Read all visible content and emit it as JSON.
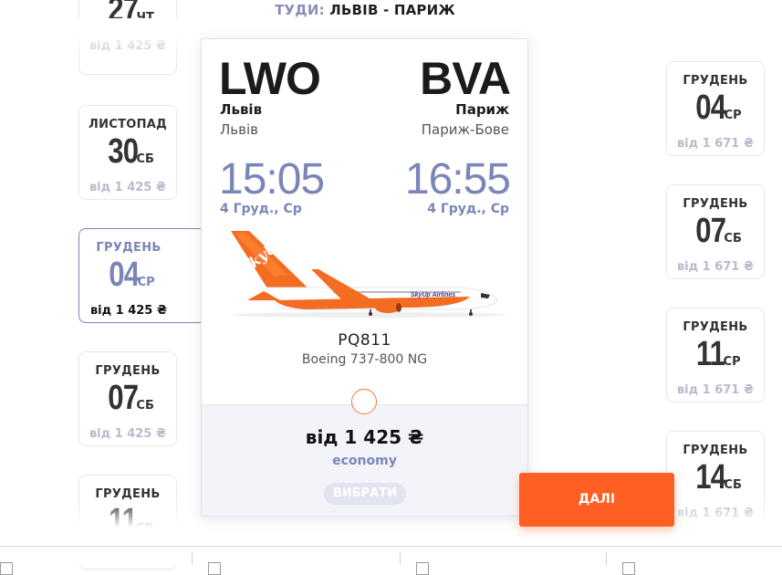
{
  "header": {
    "direction": "ТУДИ:",
    "route": "ЛЬВІВ - ПАРИЖ"
  },
  "left_dates": [
    {
      "month": "",
      "day": "27",
      "weekday": "ЧТ",
      "price": "від 1 425 ₴"
    },
    {
      "month": "ЛИСТОПАД",
      "day": "30",
      "weekday": "СБ",
      "price": "від 1 425 ₴"
    },
    {
      "month": "ГРУДЕНЬ",
      "day": "04",
      "weekday": "СР",
      "price": "від 1 425 ₴"
    },
    {
      "month": "ГРУДЕНЬ",
      "day": "07",
      "weekday": "СБ",
      "price": "від 1 425 ₴"
    },
    {
      "month": "ГРУДЕНЬ",
      "day": "11",
      "weekday": "СР",
      "price": ""
    }
  ],
  "right_dates": [
    {
      "month": "ГРУДЕНЬ",
      "day": "04",
      "weekday": "СР",
      "price": "від 1 671 ₴"
    },
    {
      "month": "ГРУДЕНЬ",
      "day": "07",
      "weekday": "СБ",
      "price": "від 1 671 ₴"
    },
    {
      "month": "ГРУДЕНЬ",
      "day": "11",
      "weekday": "СР",
      "price": "від 1 671 ₴"
    },
    {
      "month": "ГРУДЕНЬ",
      "day": "14",
      "weekday": "СБ",
      "price": "від 1 671 ₴"
    }
  ],
  "flight": {
    "origin": {
      "code": "LWO",
      "city": "Львів",
      "airport": "Львів",
      "time": "15:05",
      "date": "4 Груд., Ср"
    },
    "destination": {
      "code": "BVA",
      "city": "Париж",
      "airport": "Париж-Бове",
      "time": "16:55",
      "date": "4 Груд., Ср"
    },
    "aircraft_logo": "SkyUp",
    "aircraft_brand": "SkyUp Airlines",
    "number": "PQ811",
    "model": "Boeing 737-800 NG",
    "fare": "від 1 425 ₴",
    "fare_class": "economy",
    "select_label": "ВИБРАТИ"
  },
  "next_label": "ДАЛІ",
  "colors": {
    "accent": "#7b86b8",
    "orange": "#ff5f22",
    "muted": "#b8bbcc"
  }
}
